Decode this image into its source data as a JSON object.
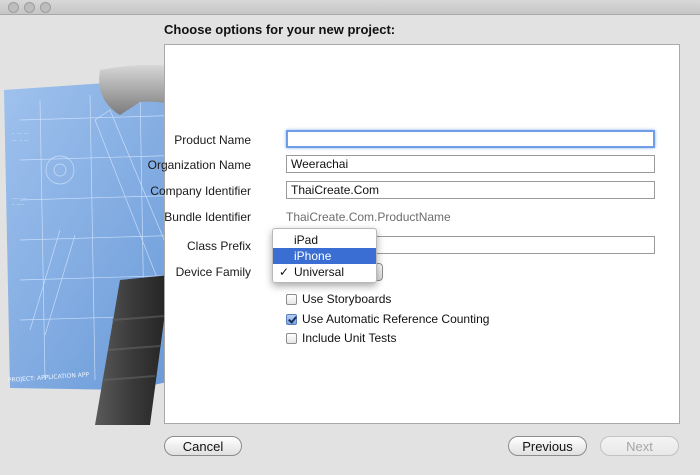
{
  "heading": "Choose options for your new project:",
  "form": {
    "product_name": {
      "label": "Product Name",
      "value": ""
    },
    "organization_name": {
      "label": "Organization Name",
      "value": "Weerachai"
    },
    "company_identifier": {
      "label": "Company Identifier",
      "value": "ThaiCreate.Com"
    },
    "bundle_identifier": {
      "label": "Bundle Identifier",
      "value": "ThaiCreate.Com.ProductName"
    },
    "class_prefix": {
      "label": "Class Prefix",
      "value": ""
    },
    "device_family": {
      "label": "Device Family",
      "options": [
        "iPad",
        "iPhone",
        "Universal"
      ],
      "highlighted": "iPhone",
      "checked": "Universal",
      "check_mark": "✓"
    }
  },
  "options": [
    {
      "label": "Use Storyboards",
      "checked": false
    },
    {
      "label": "Use Automatic Reference Counting",
      "checked": true
    },
    {
      "label": "Include Unit Tests",
      "checked": false
    }
  ],
  "buttons": {
    "cancel": "Cancel",
    "previous": "Previous",
    "next": "Next"
  },
  "hero": {
    "blueprint_caption": "PROJECT: APPLICATION APP"
  }
}
